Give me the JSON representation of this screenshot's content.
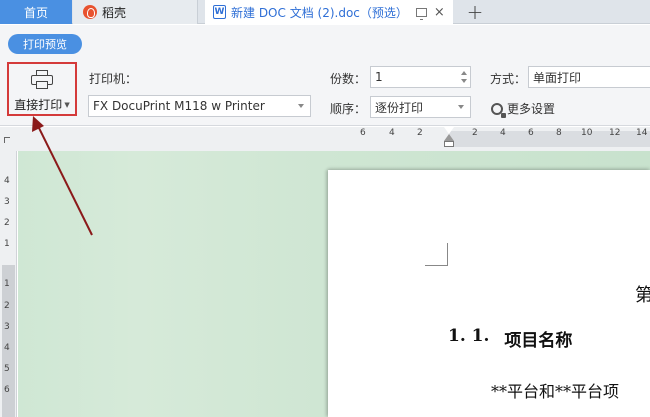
{
  "tabs": {
    "home": "首页",
    "daoke": "稻壳",
    "document": "新建 DOC 文档 (2).doc（预选）",
    "doc_icon_letter": "W",
    "close_glyph": "×",
    "add_glyph": "+"
  },
  "toolbar": {
    "preview_badge": "打印预览",
    "direct_print_label": "直接打印",
    "printer_label": "打印机：",
    "printer_value": "FX DocuPrint M118 w Printer",
    "copies_label": "份数：",
    "copies_value": "1",
    "order_label": "顺序：",
    "order_value": "逐份打印",
    "mode_label": "方式：",
    "mode_value": "单面打印",
    "more_settings": "更多设置"
  },
  "ruler": {
    "horizontal_ticks": [
      "6",
      "4",
      "2",
      "2",
      "4",
      "6",
      "8",
      "10",
      "12",
      "14"
    ],
    "vertical_ticks": [
      "4",
      "3",
      "2",
      "1",
      "1",
      "2",
      "3",
      "4",
      "5",
      "6"
    ]
  },
  "document": {
    "chapter_char": "第",
    "heading_number": "1. 1.",
    "heading_text": "项目名称",
    "body_text": "**平台和**平台项"
  },
  "colors": {
    "accent": "#4a90e2",
    "highlight_box": "#d43a3a",
    "annotation_arrow": "#8b1a1a",
    "canvas_green": "#cfe7d4"
  }
}
